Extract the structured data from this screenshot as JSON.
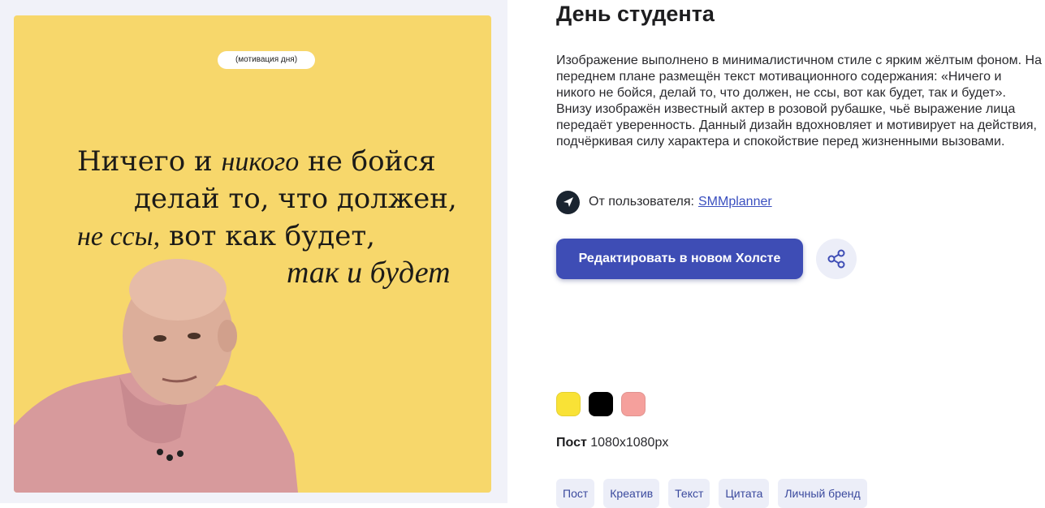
{
  "preview": {
    "badge": "(мотивация дня)",
    "quote": {
      "line1_a": "Ничего и ",
      "line1_b": "никого",
      "line1_c": " не бойся",
      "line2": "делай то, что должен,",
      "line3_a": "не ссы,",
      "line3_b": " вот как будет,",
      "line4": "так и будет"
    }
  },
  "details": {
    "title": "День студента",
    "description": "Изображение выполнено в минималистичном стиле с ярким жёлтым фоном. На переднем плане размещён текст мотивационного содержания: «Ничего и никого не бойся, делай то, что должен, не ссы, вот как будет, так и будет». Внизу изображён известный актер в розовой рубашке, чьё выражение лица передаёт уверенность. Данный дизайн вдохновляет и мотивирует на действия, подчёркивая силу характера и спокойствие перед жизненными вызовами.",
    "author_label": "От пользователя:",
    "author_name": "SMMplanner",
    "author_icon": "paper-plane-icon",
    "edit_button": "Редактировать в новом Холсте",
    "share_icon": "share-icon",
    "colors": [
      "#f9e236",
      "#000000",
      "#f5a09c"
    ],
    "format_label": "Пост",
    "format_size": "1080x1080px",
    "tags": [
      "Пост",
      "Креатив",
      "Текст",
      "Цитата",
      "Личный бренд"
    ]
  },
  "theme": {
    "accent": "#3e4db5",
    "preview_bg": "#f7d76b",
    "panel_bg": "#f1f2f9"
  }
}
